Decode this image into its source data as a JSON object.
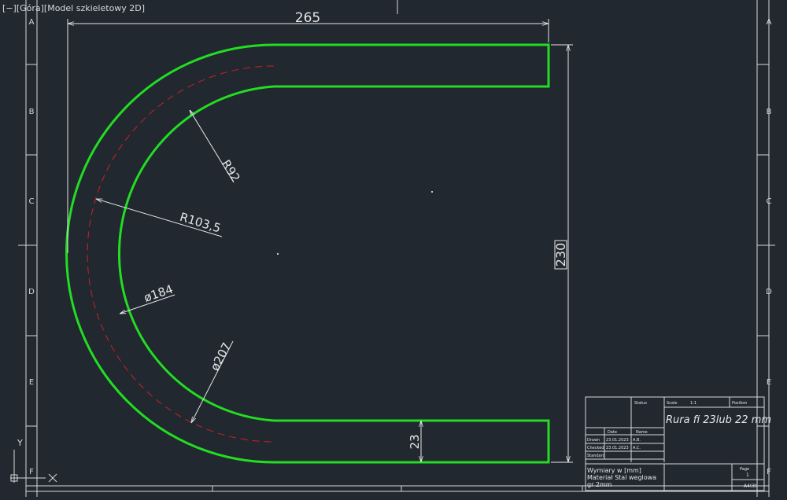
{
  "viewport": {
    "minimize_control": "[−]",
    "view_name": "[Góra]",
    "visual_style": "[Model szkieletowy 2D]"
  },
  "frame": {
    "zones_left": [
      "A",
      "B",
      "C",
      "D",
      "E",
      "F"
    ],
    "zones_right": [
      "A",
      "B",
      "C",
      "D",
      "E",
      "F"
    ]
  },
  "dimensions": {
    "width": "265",
    "height": "230",
    "inner_radius": "R92",
    "center_radius": "R103,5",
    "inner_diameter": "ø184",
    "outer_diameter": "ø207",
    "tube_width": "23"
  },
  "title_block": {
    "title": "Rura fi 23lub 22 mm",
    "header_status": "Status",
    "header_scale": "Scale",
    "scale_value": "1:1",
    "header_position": "Position",
    "header_date": "Date",
    "header_name": "Name",
    "row_drawn": "Drawn",
    "row_checked": "Checked",
    "row_standard": "Standard",
    "drawn_date": "23.01.2023",
    "drawn_name": "A.B.",
    "checked_date": "23.01.2023",
    "checked_name": "A.C.",
    "notes": [
      "Wymiary w [mm]",
      "Materiał Stal weglowa",
      "gr 2mm"
    ],
    "page_label": "Page",
    "page_number": "1",
    "sheet_format": "A4(3)"
  },
  "ucs": {
    "y_label": "Y",
    "x_label": "X"
  },
  "colors": {
    "background": "#212830",
    "part_outline": "#22dd22",
    "centerline": "#cc2222",
    "annotation": "#e6e6e6",
    "frame": "#d8d8d8"
  }
}
